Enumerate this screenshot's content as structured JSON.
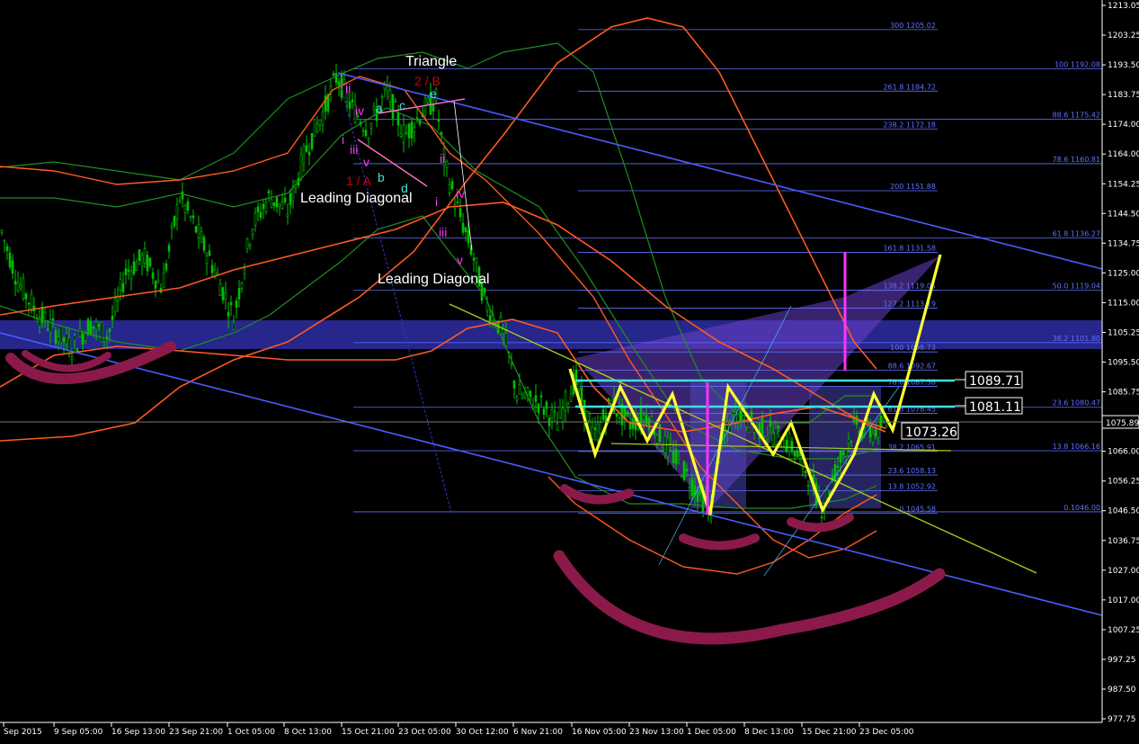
{
  "chart_data": {
    "type": "line",
    "title": "",
    "instrument_note": "",
    "ylim": [
      977.75,
      1213.0
    ],
    "y_ticks": [
      "1213.05",
      "1203.25",
      "1193.50",
      "1183.75",
      "1174.00",
      "1164.00",
      "1154.25",
      "1144.50",
      "1134.75",
      "1125.00",
      "1115.00",
      "1105.25",
      "1095.50",
      "1085.75",
      "1076.00",
      "1066.00",
      "1056.25",
      "1046.50",
      "1036.75",
      "1027.00",
      "1017.00",
      "1007.25",
      "997.25",
      "987.50",
      "977.75"
    ],
    "x_ticks": [
      "Sep 2015",
      "9 Sep 05:00",
      "16 Sep 13:00",
      "23 Sep 21:00",
      "1 Oct 05:00",
      "8 Oct 13:00",
      "15 Oct 21:00",
      "23 Oct 05:00",
      "30 Oct 12:00",
      "6 Nov 21:00",
      "16 Nov 05:00",
      "23 Nov 13:00",
      "1 Dec 05:00",
      "8 Dec 13:00",
      "15 Dec 21:00",
      "23 Dec 05:00"
    ],
    "current_price": "1075.89",
    "price_boxes": [
      "1089.71",
      "1081.11",
      "1073.26"
    ],
    "fib_right": [
      {
        "label": "100 1192.08",
        "value": 1192.08
      },
      {
        "label": "88.6 1175.42",
        "value": 1175.42
      },
      {
        "label": "78.6 1160.81",
        "value": 1160.81
      },
      {
        "label": "61.8 1136.27",
        "value": 1136.27
      },
      {
        "label": "50.0 1119.04",
        "value": 1119.04
      },
      {
        "label": "38.2 1101.80",
        "value": 1101.8
      },
      {
        "label": "23.6 1080.47",
        "value": 1080.47
      },
      {
        "label": "13.8 1066.16",
        "value": 1066.16
      },
      {
        "label": "0.1046.00",
        "value": 1046.0
      }
    ],
    "fib_mid": [
      {
        "label": "300 1205.02",
        "value": 1205.02
      },
      {
        "label": "261.8 1184.72",
        "value": 1184.72
      },
      {
        "label": "238.2 1172.18",
        "value": 1172.18
      },
      {
        "label": "200 1151.88",
        "value": 1151.88
      },
      {
        "label": "161.8 1131.58",
        "value": 1131.58
      },
      {
        "label": "138.2 1119.05",
        "value": 1119.05
      },
      {
        "label": "127.2 1113.19",
        "value": 1113.19
      },
      {
        "label": "100 1098.73",
        "value": 1098.73
      },
      {
        "label": "88.6 1092.67",
        "value": 1092.67
      },
      {
        "label": "78.6 1087.38",
        "value": 1087.38
      },
      {
        "label": "61.8 1078.45",
        "value": 1078.45
      },
      {
        "label": "38.2 1065.91",
        "value": 1065.91
      },
      {
        "label": "23.6 1058.13",
        "value": 1058.13
      },
      {
        "label": "13.8 1052.92",
        "value": 1052.92
      },
      {
        "label": "0.1045.58",
        "value": 1045.58
      }
    ],
    "annotations": {
      "triangle": "Triangle",
      "label_2b": "2 / B",
      "label_1a": "1 / A",
      "leading_diagonal_1": "Leading Diagonal",
      "leading_diagonal_2": "Leading Diagonal",
      "waves": [
        "i",
        "ii",
        "iii",
        "iv",
        "v",
        "a",
        "b",
        "c",
        "d",
        "e",
        "i",
        "ii",
        "iii",
        "iv",
        "v"
      ]
    },
    "colors": {
      "background": "#000000",
      "candles": "#00c000",
      "bollinger": "#1f8f1f",
      "moving_average": "#ff5a1f",
      "channel": "#4a5cff",
      "fib": "#5f6fff",
      "pattern": "#ffff33",
      "level": "#40e0e0",
      "arcs": "#8b1a4a",
      "accent": "#ff33ff"
    }
  }
}
